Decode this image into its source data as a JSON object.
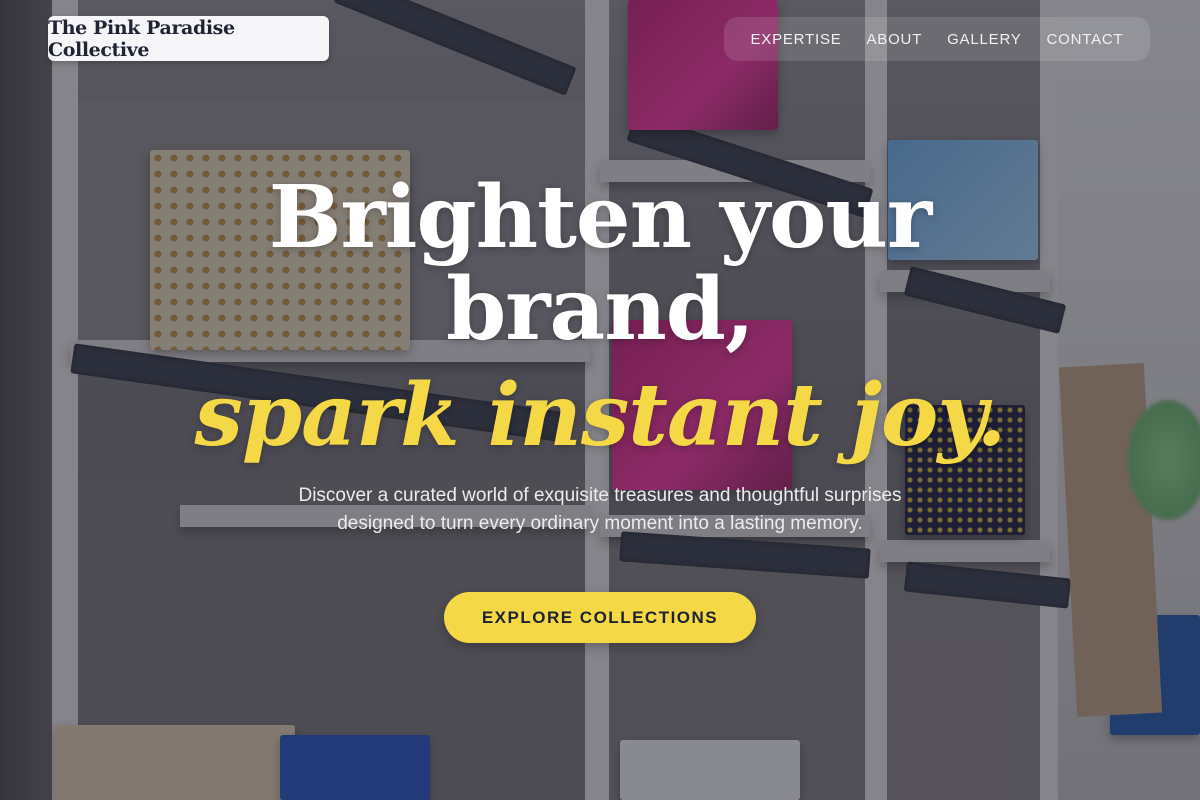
{
  "header": {
    "brand_name": "The Pink Paradise Collective",
    "nav": [
      {
        "label": "EXPERTISE"
      },
      {
        "label": "ABOUT"
      },
      {
        "label": "GALLERY"
      },
      {
        "label": "CONTACT"
      }
    ]
  },
  "hero": {
    "title_line1": "Brighten your",
    "title_line2": "brand,",
    "accent": "spark instant joy.",
    "subtitle": "Discover a curated world of exquisite treasures and thoughtful surprises designed to turn every ordinary moment into a lasting memory.",
    "cta_label": "EXPLORE COLLECTIONS"
  },
  "background": {
    "description_icon": "gift-shelves-photo"
  },
  "colors": {
    "accent": "#f5d845",
    "brand_text": "#1f2433",
    "overlay": "#14141c"
  }
}
